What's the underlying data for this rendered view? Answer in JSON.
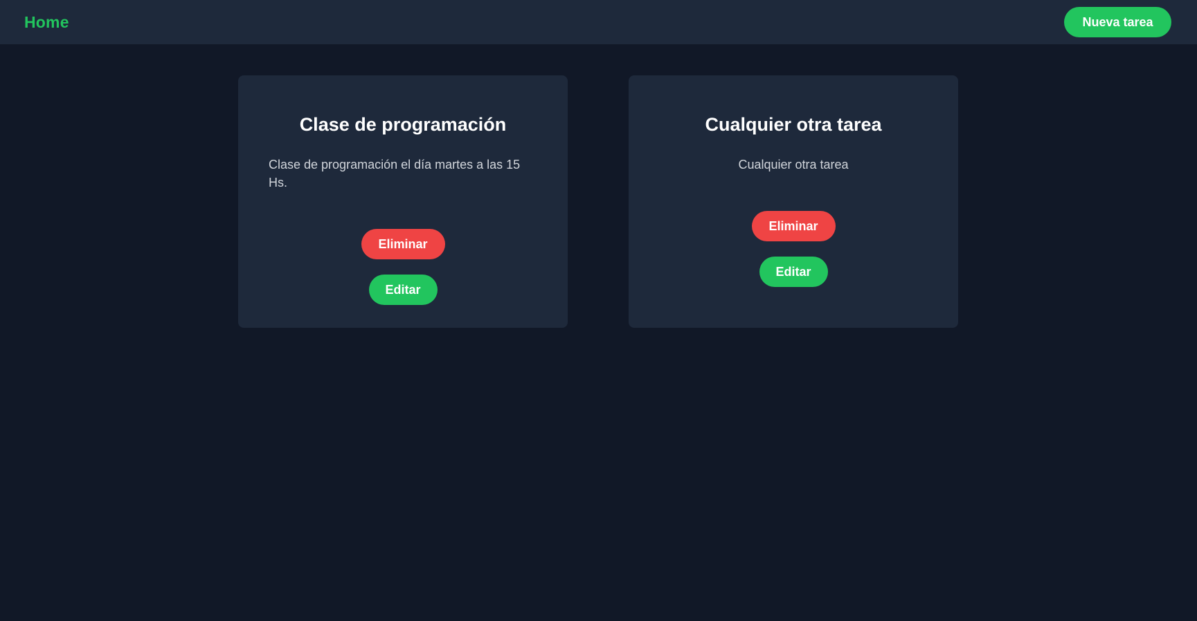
{
  "nav": {
    "home_label": "Home",
    "new_task_label": "Nueva tarea"
  },
  "tasks": [
    {
      "title": "Clase de programación",
      "description": "Clase de programación el día martes a las 15 Hs.",
      "delete_label": "Eliminar",
      "edit_label": "Editar"
    },
    {
      "title": "Cualquier otra tarea",
      "description": "Cualquier otra tarea",
      "delete_label": "Eliminar",
      "edit_label": "Editar"
    }
  ],
  "colors": {
    "background": "#111827",
    "surface": "#1e293b",
    "accent_green": "#22c55e",
    "danger_red": "#ef4444"
  }
}
